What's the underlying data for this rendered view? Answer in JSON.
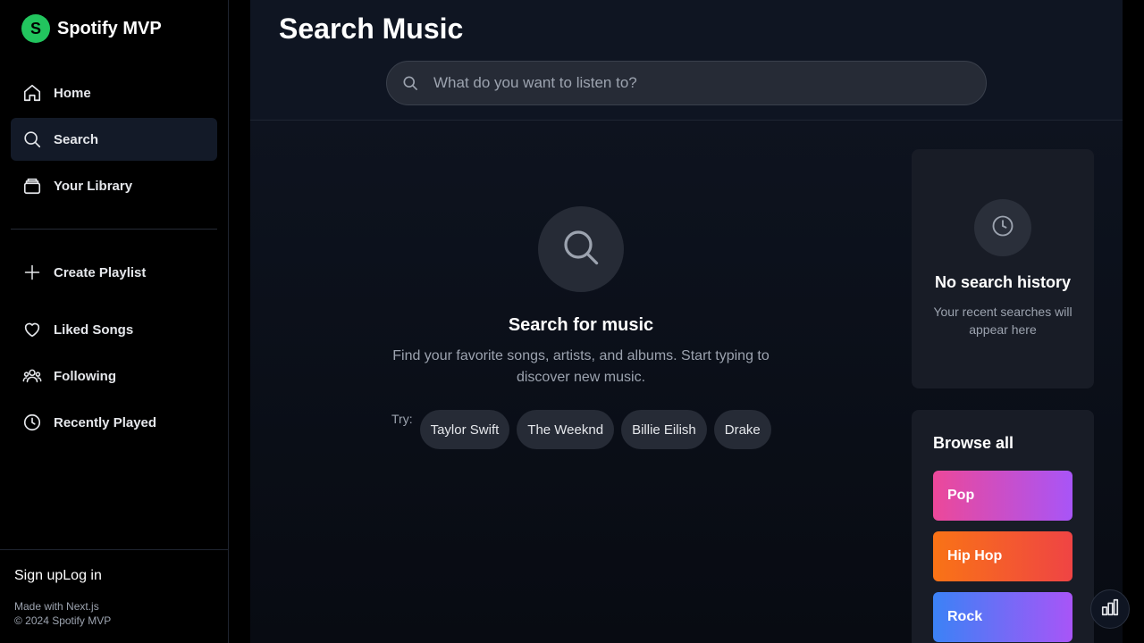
{
  "brand": {
    "logo_letter": "S",
    "name": "Spotify MVP",
    "color": "#22c55e"
  },
  "sidebar": {
    "primary": [
      {
        "label": "Home",
        "icon": "home-icon"
      },
      {
        "label": "Search",
        "icon": "search-icon",
        "active": true
      },
      {
        "label": "Your Library",
        "icon": "library-icon"
      }
    ],
    "secondary": [
      {
        "label": "Create Playlist",
        "icon": "plus-icon"
      },
      {
        "label": "Liked Songs",
        "icon": "heart-icon"
      },
      {
        "label": "Following",
        "icon": "users-icon"
      },
      {
        "label": "Recently Played",
        "icon": "clock-icon"
      }
    ],
    "footer": {
      "sign_up": "Sign up",
      "log_in": "Log in",
      "made_with": "Made with Next.js",
      "copyright": "© 2024 Spotify MVP"
    }
  },
  "header": {
    "title": "Search Music"
  },
  "search": {
    "placeholder": "What do you want to listen to?",
    "value": ""
  },
  "empty_state": {
    "title": "Search for music",
    "description": "Find your favorite songs, artists, and albums. Start typing to discover new music.",
    "try_label": "Try:",
    "suggestions": [
      "Taylor Swift",
      "The Weeknd",
      "Billie Eilish",
      "Drake"
    ]
  },
  "history": {
    "title": "No search history",
    "description": "Your recent searches will appear here"
  },
  "browse": {
    "title": "Browse all",
    "genres": [
      {
        "label": "Pop",
        "gradient": [
          "#ec4899",
          "#a855f7"
        ]
      },
      {
        "label": "Hip Hop",
        "gradient": [
          "#f97316",
          "#ef4444"
        ]
      },
      {
        "label": "Rock",
        "gradient": [
          "#3b82f6",
          "#a855f7"
        ]
      }
    ]
  },
  "fab": {
    "icon": "bar-chart-icon"
  }
}
